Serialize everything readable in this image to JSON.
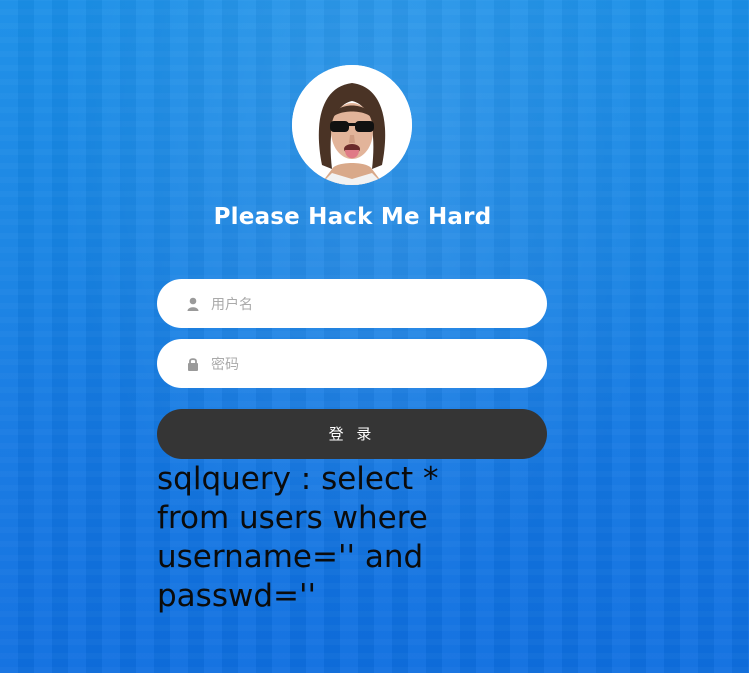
{
  "page": {
    "title": "Please Hack Me Hard"
  },
  "form": {
    "username_placeholder": "用户名",
    "password_placeholder": "密码",
    "username_icon": "user-icon",
    "password_icon": "lock-icon",
    "login_label": "登 录"
  },
  "debug": {
    "sqlquery": "sqlquery : select * from users where username='' and passwd=''"
  },
  "colors": {
    "background_top": "#1a8fe8",
    "background_bottom": "#0f6fe0",
    "button": "#353535",
    "title_text": "#ffffff",
    "sql_text": "#0b0b0b"
  }
}
